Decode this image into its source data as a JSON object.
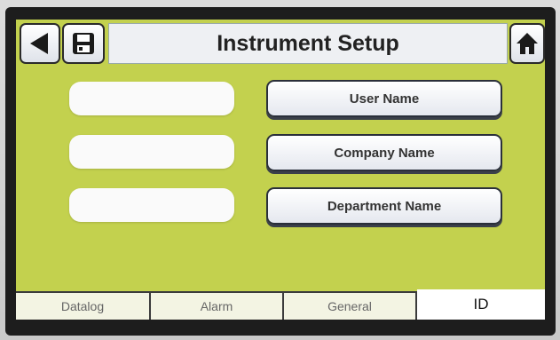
{
  "header": {
    "title": "Instrument Setup",
    "back_icon": "back-arrow-icon",
    "save_icon": "floppy-disk-icon",
    "home_icon": "home-icon"
  },
  "fields": [
    {
      "value": "",
      "button_label": "User Name"
    },
    {
      "value": "",
      "button_label": "Company Name"
    },
    {
      "value": "",
      "button_label": "Department Name"
    }
  ],
  "tabs": [
    {
      "label": "Datalog"
    },
    {
      "label": "Alarm"
    },
    {
      "label": "General"
    },
    {
      "label": "ID",
      "active": true
    }
  ],
  "colors": {
    "screen_background": "#c3d14e",
    "button_border": "#2a2a2a"
  }
}
